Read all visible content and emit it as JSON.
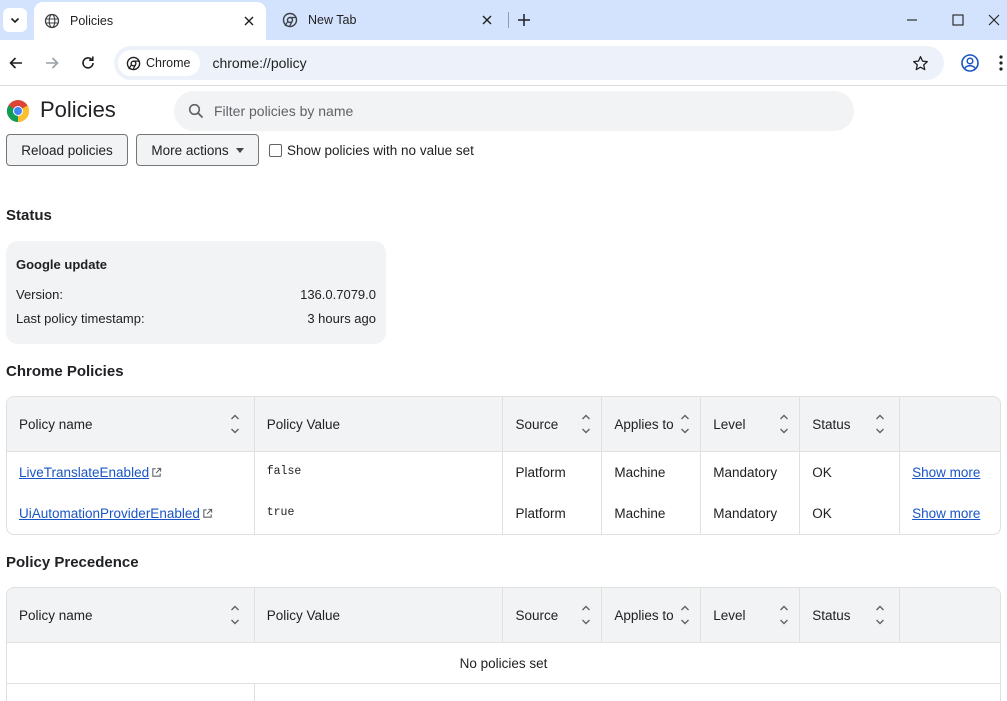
{
  "browser": {
    "tabs": [
      {
        "title": "Policies",
        "active": true
      },
      {
        "title": "New Tab",
        "active": false
      }
    ],
    "omnibox": {
      "chip_label": "Chrome",
      "url": "chrome://policy"
    }
  },
  "page": {
    "title": "Policies",
    "filter_placeholder": "Filter policies by name",
    "reload_label": "Reload policies",
    "more_actions_label": "More actions",
    "show_unset_label": "Show policies with no value set",
    "show_unset_checked": false
  },
  "status": {
    "section_title": "Status",
    "heading": "Google update",
    "rows": [
      {
        "label": "Version:",
        "value": "136.0.7079.0"
      },
      {
        "label": "Last policy timestamp:",
        "value": "3 hours ago"
      }
    ]
  },
  "chrome_policies": {
    "section_title": "Chrome Policies",
    "columns": [
      "Policy name",
      "Policy Value",
      "Source",
      "Applies to",
      "Level",
      "Status"
    ],
    "rows": [
      {
        "name": "LiveTranslateEnabled",
        "value": "false",
        "source": "Platform",
        "applies_to": "Machine",
        "level": "Mandatory",
        "status": "OK",
        "action": "Show more"
      },
      {
        "name": "UiAutomationProviderEnabled",
        "value": "true",
        "source": "Platform",
        "applies_to": "Machine",
        "level": "Mandatory",
        "status": "OK",
        "action": "Show more"
      }
    ]
  },
  "policy_precedence": {
    "section_title": "Policy Precedence",
    "columns": [
      "Policy name",
      "Policy Value",
      "Source",
      "Applies to",
      "Level",
      "Status"
    ],
    "empty_text": "No policies set"
  },
  "colors": {
    "tabstrip": "#d3e3fd",
    "omnibox": "#edf2fa",
    "link": "#1a55c5",
    "panel": "#f1f3f4"
  }
}
